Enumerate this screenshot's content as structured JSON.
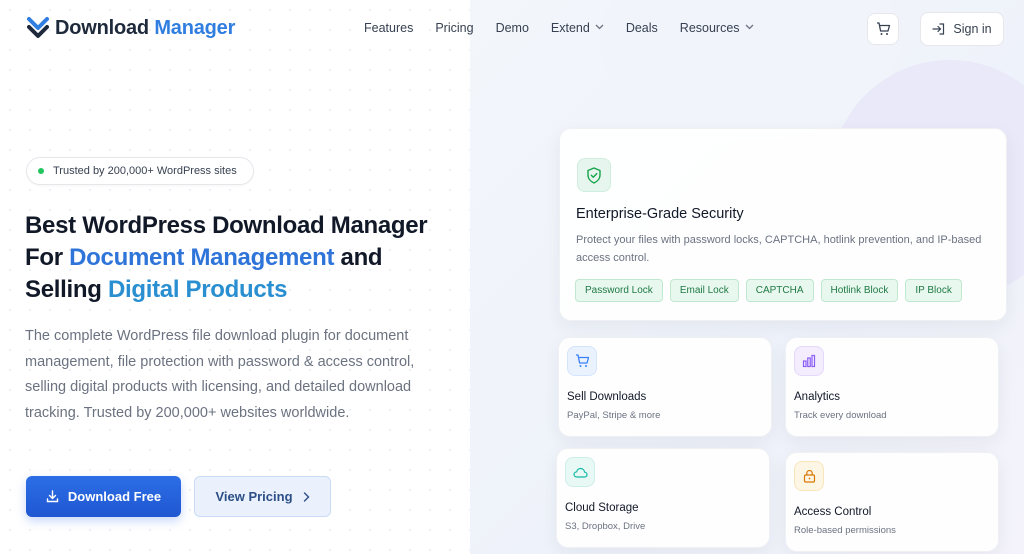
{
  "header": {
    "logo": {
      "part1": "Download",
      "part2": "Manager"
    },
    "nav": [
      {
        "label": "Features",
        "has_dropdown": false
      },
      {
        "label": "Pricing",
        "has_dropdown": false
      },
      {
        "label": "Demo",
        "has_dropdown": false
      },
      {
        "label": "Extend",
        "has_dropdown": true
      },
      {
        "label": "Deals",
        "has_dropdown": false
      },
      {
        "label": "Resources",
        "has_dropdown": true
      }
    ],
    "cart_icon": "cart-icon",
    "signin_label": "Sign in"
  },
  "hero": {
    "badge": "Trusted by 200,000+ WordPress sites",
    "headline": {
      "line1": "Best WordPress Download Manager",
      "line2_prefix": "For ",
      "line2_highlight": "Document Management",
      "line2_suffix": " and",
      "line3_prefix": "Selling ",
      "line3_highlight": "Digital Products"
    },
    "description": "The complete WordPress file download plugin for document management, file protection with password & access control, selling digital products with licensing, and detailed download tracking. Trusted by 200,000+ websites worldwide.",
    "primary_button": "Download Free",
    "secondary_button": "View Pricing"
  },
  "security_card": {
    "icon": "shield-check-icon",
    "title": "Enterprise-Grade Security",
    "description": "Protect your files with password locks, CAPTCHA, hotlink prevention, and IP-based access control.",
    "tags": [
      "Password Lock",
      "Email Lock",
      "CAPTCHA",
      "Hotlink Block",
      "IP Block"
    ]
  },
  "feature_cards": [
    {
      "icon": "cart-icon",
      "title": "Sell Downloads",
      "subtitle": "PayPal, Stripe & more",
      "accent": "#3b82f6"
    },
    {
      "icon": "bar-chart-icon",
      "title": "Analytics",
      "subtitle": "Track every download",
      "accent": "#8b5cf6"
    },
    {
      "icon": "cloud-icon",
      "title": "Cloud Storage",
      "subtitle": "S3, Dropbox, Drive",
      "accent": "#14b8a6"
    },
    {
      "icon": "lock-icon",
      "title": "Access Control",
      "subtitle": "Role-based permissions",
      "accent": "#d97706"
    }
  ],
  "colors": {
    "brand_dark": "#1e2a3b",
    "brand_blue": "#2f7ee0",
    "primary_button": "#2563eb",
    "success_green": "#22c55e"
  }
}
